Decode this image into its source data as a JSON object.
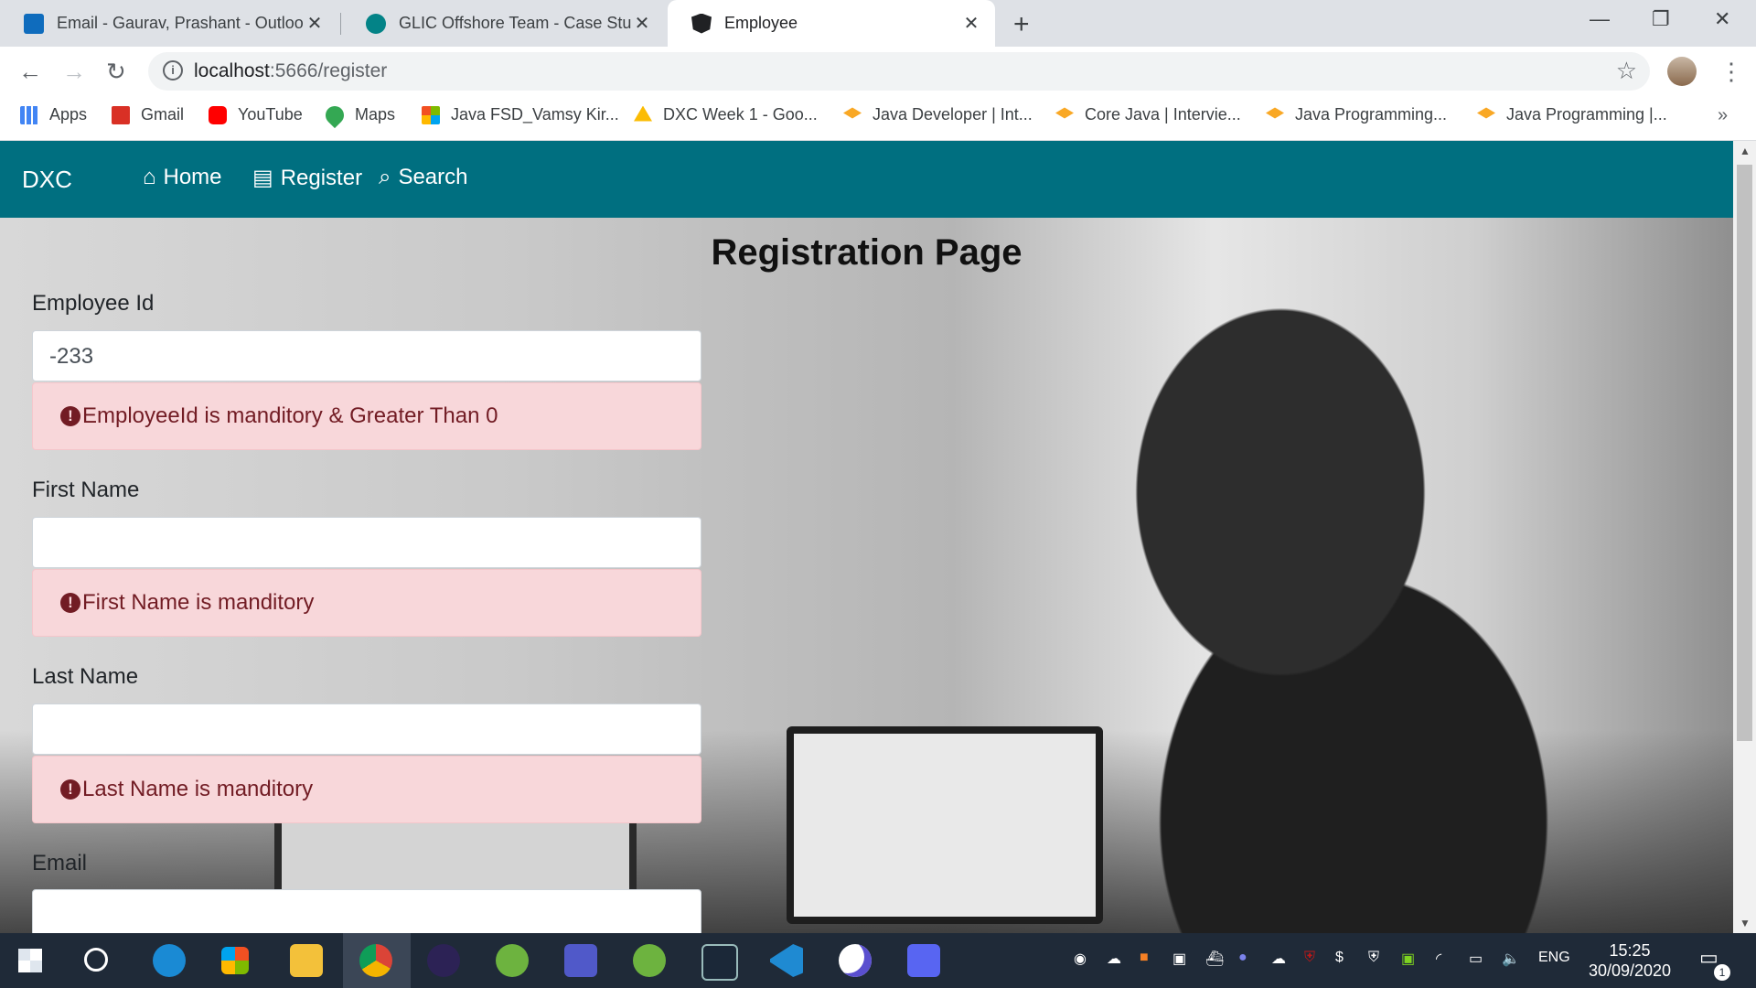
{
  "browser": {
    "tabs": [
      {
        "title": "Email - Gaurav, Prashant - Outloo",
        "icon": "outlook-icon",
        "color": "#0f6cbd"
      },
      {
        "title": "GLIC Offshore Team - Case Study",
        "icon": "sharepoint-icon",
        "color": "#038387"
      },
      {
        "title": "Employee",
        "icon": "angular-icon",
        "color": "#202124"
      }
    ],
    "url_host": "localhost",
    "url_path": ":5666/register",
    "bookmarks": [
      {
        "label": "Apps",
        "icon": "apps-grid-icon",
        "color": "#e8453c"
      },
      {
        "label": "Gmail",
        "icon": "gmail-icon",
        "color": "#d93025"
      },
      {
        "label": "YouTube",
        "icon": "youtube-icon",
        "color": "#ff0000"
      },
      {
        "label": "Maps",
        "icon": "maps-pin-icon",
        "color": "#34a853"
      },
      {
        "label": "Java FSD_Vamsy Kir...",
        "icon": "microsoft-icon",
        "color": "#f25022"
      },
      {
        "label": "DXC Week 1 - Goo...",
        "icon": "drive-icon",
        "color": "#fbbc04"
      },
      {
        "label": "Java Developer | Int...",
        "icon": "graduation-cap-icon",
        "color": "#f9a825"
      },
      {
        "label": "Core Java | Intervie...",
        "icon": "graduation-cap-icon",
        "color": "#f9a825"
      },
      {
        "label": "Java Programming...",
        "icon": "graduation-cap-icon",
        "color": "#f9a825"
      },
      {
        "label": "Java Programming |...",
        "icon": "graduation-cap-icon",
        "color": "#f9a825"
      }
    ],
    "more": "»"
  },
  "app": {
    "brand": "DXC",
    "nav": [
      {
        "label": "Home",
        "icon": "home-icon"
      },
      {
        "label": "Register",
        "icon": "document-icon"
      },
      {
        "label": "Search",
        "icon": "search-icon"
      }
    ],
    "navbar_color": "#006f80",
    "page_title": "Registration Page",
    "form": {
      "employee_id": {
        "label": "Employee Id",
        "value": "-233",
        "error": "EmployeeId is manditory & Greater Than 0"
      },
      "first_name": {
        "label": "First Name",
        "value": "",
        "error": "First Name is manditory"
      },
      "last_name": {
        "label": "Last Name",
        "value": "",
        "error": "Last Name is manditory"
      },
      "email": {
        "label": "Email",
        "value": ""
      }
    },
    "error_bg": "#f8d7da",
    "error_text": "#721c24"
  },
  "taskbar": {
    "apps": [
      "windows-start-icon",
      "search-icon",
      "edge-icon",
      "store-icon",
      "file-explorer-icon",
      "chrome-icon",
      "eclipse-icon",
      "spring-tools-icon",
      "teams-icon",
      "spring-tools-icon",
      "mysql-icon",
      "vscode-icon",
      "app-icon",
      "discord-icon"
    ],
    "language": "ENG",
    "time": "15:25",
    "date": "30/09/2020",
    "notifications": "1"
  }
}
